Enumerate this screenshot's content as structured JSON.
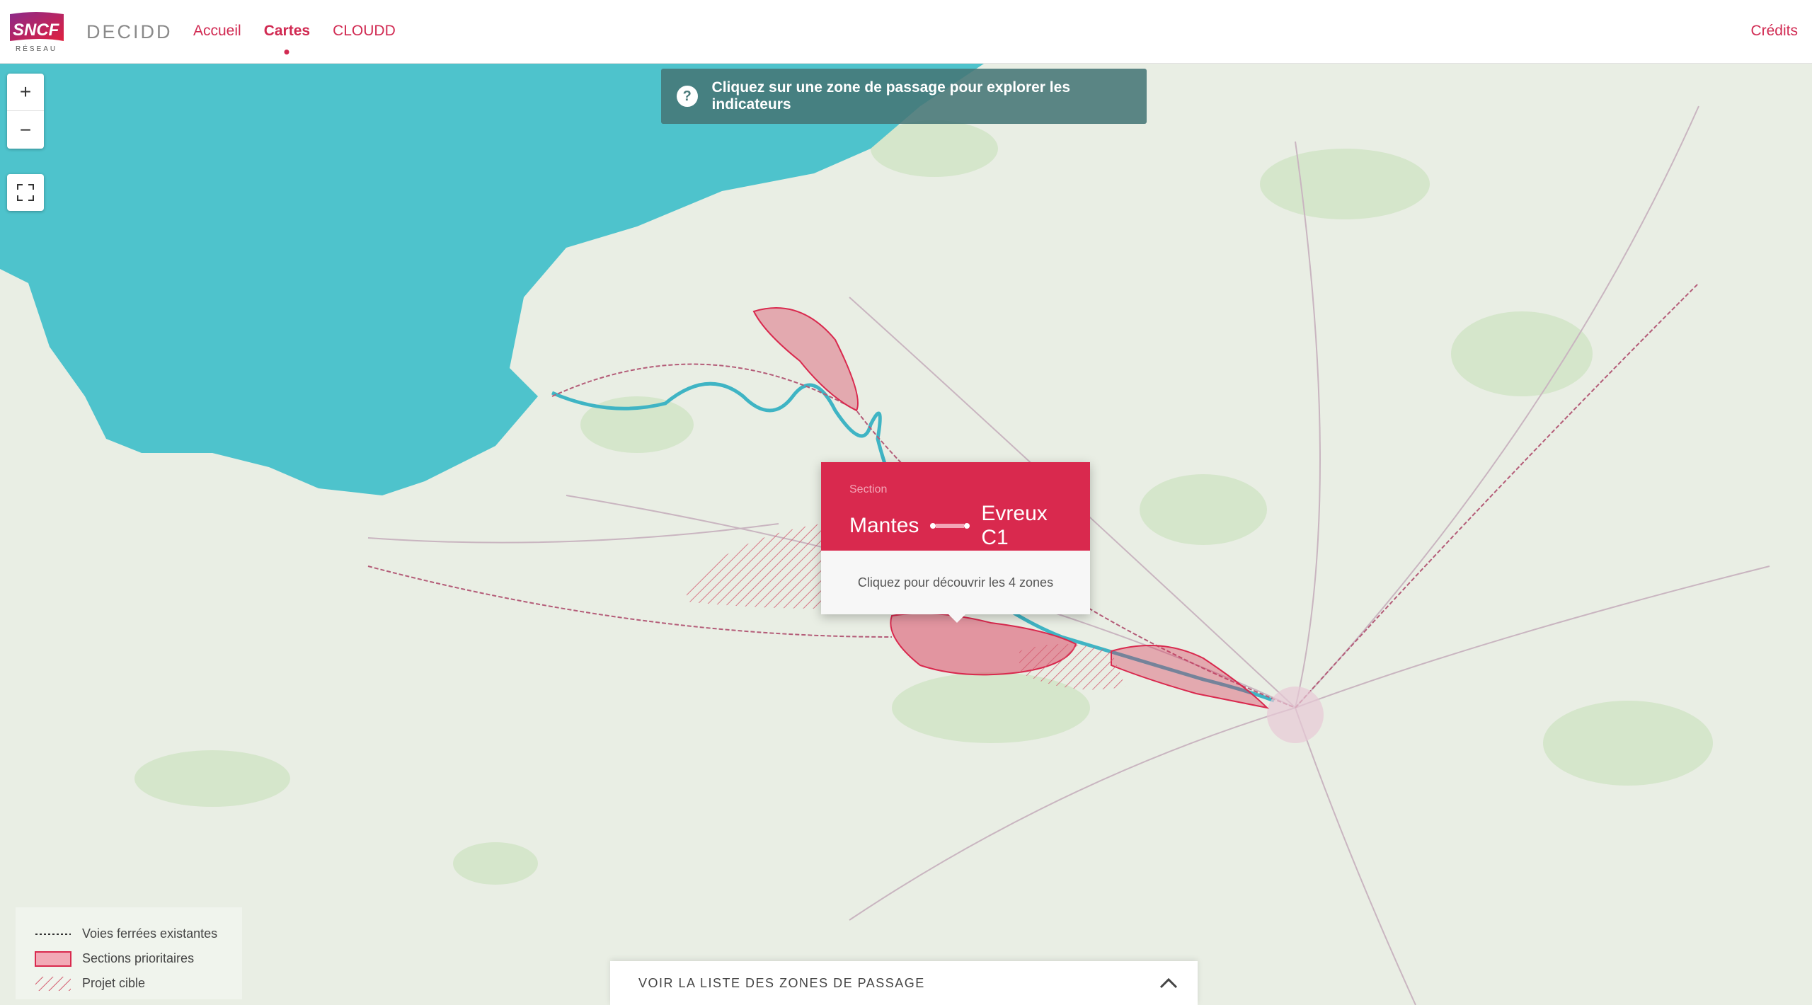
{
  "header": {
    "app_name": "DECIDD",
    "nav": [
      {
        "label": "Accueil"
      },
      {
        "label": "Cartes"
      },
      {
        "label": "CLOUDD"
      }
    ],
    "credits": "Crédits"
  },
  "map": {
    "zoom_in": "+",
    "zoom_out": "−",
    "fullscreen_icon": "fullscreen-icon",
    "banner_icon": "?",
    "banner_text": "Cliquez sur une zone de passage pour explorer les indicateurs"
  },
  "popup": {
    "label": "Section",
    "from": "Mantes",
    "to": "Evreux C1",
    "cta": "Cliquez pour découvrir les 4 zones"
  },
  "legend": [
    {
      "label": "Voies ferrées existantes"
    },
    {
      "label": "Sections prioritaires"
    },
    {
      "label": "Projet cible"
    }
  ],
  "bottom_bar": {
    "label": "VOIR LA LISTE DES ZONES DE PASSAGE",
    "icon": "chevron-up-icon"
  },
  "colors": {
    "brand": "#d12a52",
    "popup": "#d9294e",
    "sea": "#4ec3cc",
    "land": "#e9eee4",
    "banner": "#467676"
  }
}
